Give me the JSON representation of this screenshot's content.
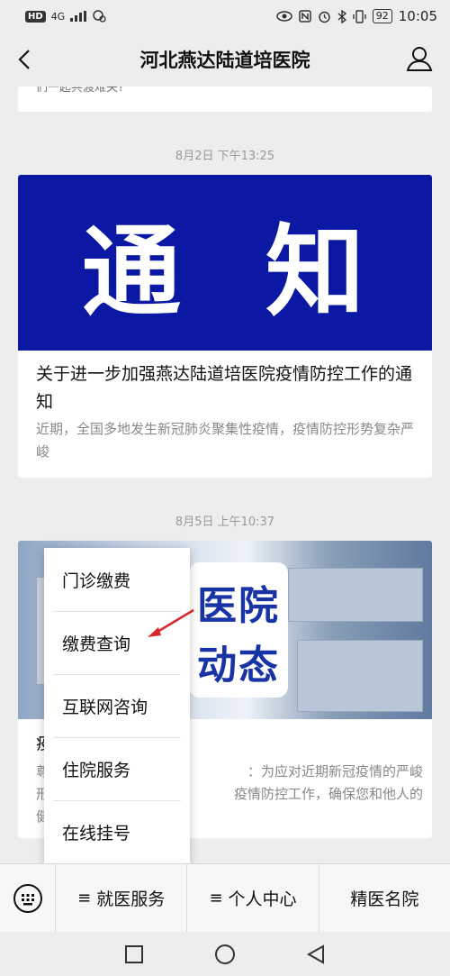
{
  "status_bar": {
    "hd": "HD",
    "network": "4G",
    "battery": "92",
    "time": "10:05"
  },
  "header": {
    "title": "河北燕达陆道培医院"
  },
  "feed": {
    "card1_text": "们一起共渡难关?",
    "time1": "8月2日 下午13:25",
    "article1": {
      "banner": [
        "通",
        "知"
      ],
      "title": "关于进一步加强燕达陆道培医院疫情防控工作的通知",
      "summary": "近期，全国多地发生新冠肺炎聚集性疫情，疫情防控形势复杂严峻"
    },
    "time2": "8月5日 上午10:37",
    "article2": {
      "badge_line1": "医院",
      "badge_line2": "动态",
      "title_fragment": "疫",
      "summary_line1_left": "尊",
      "summary_line1_right": "：为应对近期新冠疫情的严峻",
      "summary_line2_left": "形",
      "summary_line2_right": "疫情防控工作，确保您和他人的",
      "summary_line3_left": "健"
    }
  },
  "popup_menu": {
    "items": [
      "门诊缴费",
      "缴费查询",
      "互联网咨询",
      "住院服务",
      "在线挂号"
    ]
  },
  "bottom_menu": {
    "items": [
      {
        "label": "就医服务",
        "has_submenu": true
      },
      {
        "label": "个人中心",
        "has_submenu": true
      },
      {
        "label": "精医名院",
        "has_submenu": false
      }
    ],
    "hamburger": "≡"
  },
  "colors": {
    "banner_blue": "#0a18a3",
    "badge_blue": "#1733a6",
    "arrow_red": "#d9262b",
    "background": "#ededed"
  }
}
